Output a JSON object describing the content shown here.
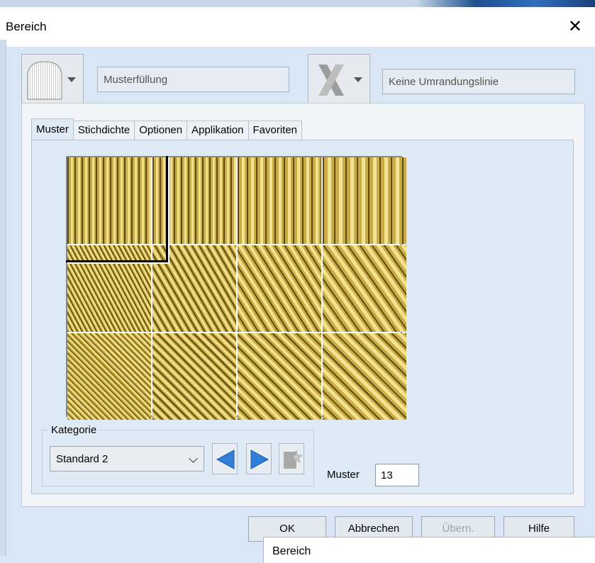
{
  "dialog": {
    "title": "Bereich",
    "close_glyph": "✕"
  },
  "fill": {
    "field_text": "Musterfüllung",
    "icon": "pattern-fill-icon"
  },
  "border": {
    "field_text": "Keine Umrandungslinie",
    "icon": "no-border-icon"
  },
  "tabs": [
    {
      "label": "Muster",
      "active": true
    },
    {
      "label": "Stichdichte",
      "active": false
    },
    {
      "label": "Optionen",
      "active": false
    },
    {
      "label": "Applikation",
      "active": false
    },
    {
      "label": "Favoriten",
      "active": false
    }
  ],
  "pattern_grid": {
    "rows": 3,
    "columns": 4,
    "selected_index": 0
  },
  "kategorie": {
    "label": "Kategorie",
    "selected": "Standard 2"
  },
  "muster": {
    "label": "Muster",
    "value": "13"
  },
  "buttons": {
    "ok": "OK",
    "cancel": "Abbrechen",
    "apply": "Übern.",
    "help": "Hilfe"
  },
  "sub_window": {
    "title": "Bereich"
  },
  "colors": {
    "nav_arrow": "#2f7fd8",
    "pattern_gold": "#d8c15c"
  }
}
